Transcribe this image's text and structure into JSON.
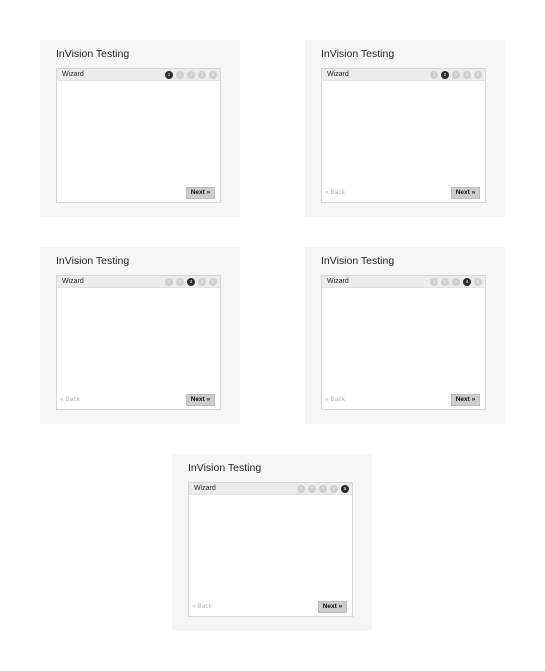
{
  "cards": [
    {
      "title": "InVision Testing",
      "panel_label": "Wizard",
      "steps": [
        "1",
        "2",
        "3",
        "4",
        "5"
      ],
      "active_step": 1,
      "back_label": "",
      "next_label": "Next »"
    },
    {
      "title": "InVision Testing",
      "panel_label": "Wizard",
      "steps": [
        "1",
        "2",
        "3",
        "4",
        "5"
      ],
      "active_step": 2,
      "back_label": "« Back",
      "next_label": "Next »"
    },
    {
      "title": "InVision Testing",
      "panel_label": "Wizard",
      "steps": [
        "1",
        "2",
        "3",
        "4",
        "5"
      ],
      "active_step": 3,
      "back_label": "« Back",
      "next_label": "Next »"
    },
    {
      "title": "InVision Testing",
      "panel_label": "Wizard",
      "steps": [
        "1",
        "2",
        "3",
        "4",
        "5"
      ],
      "active_step": 4,
      "back_label": "« Back",
      "next_label": "Next »"
    },
    {
      "title": "InVision Testing",
      "panel_label": "Wizard",
      "steps": [
        "1",
        "2",
        "3",
        "4",
        "5"
      ],
      "active_step": 5,
      "back_label": "« Back",
      "next_label": "Next »"
    }
  ],
  "colors": {
    "card_background": "#f6f6f6",
    "active_step": "#2d2d2d",
    "inactive_step": "#cfcfcf",
    "next_button": "#cdcdcd",
    "back_text": "#b6b6b6"
  }
}
